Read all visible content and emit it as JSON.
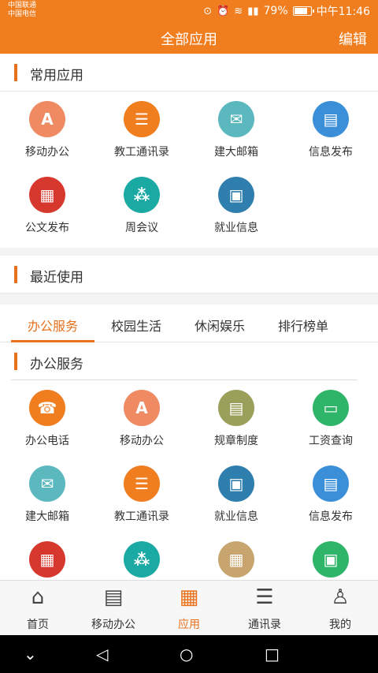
{
  "status": {
    "carrier1": "中国联通",
    "carrier2": "中国电信",
    "battery": "79%",
    "time": "中午11:46"
  },
  "nav": {
    "title": "全部应用",
    "edit": "编辑"
  },
  "common": {
    "title": "常用应用",
    "items": [
      {
        "label": "移动办公",
        "icon": "A",
        "color": "#f08a62"
      },
      {
        "label": "教工通讯录",
        "icon": "☰",
        "color": "#f07d1e"
      },
      {
        "label": "建大邮箱",
        "icon": "✉",
        "color": "#5ab8be"
      },
      {
        "label": "信息发布",
        "icon": "▤",
        "color": "#3a8fd8"
      },
      {
        "label": "公文发布",
        "icon": "▦",
        "color": "#d7382e"
      },
      {
        "label": "周会议",
        "icon": "⁂",
        "color": "#1aa9a3"
      },
      {
        "label": "就业信息",
        "icon": "▣",
        "color": "#2f7fae"
      }
    ]
  },
  "recent": {
    "title": "最近使用"
  },
  "tabs": [
    "办公服务",
    "校园生活",
    "休闲娱乐",
    "排行榜单"
  ],
  "office": {
    "title": "办公服务",
    "items": [
      {
        "label": "办公电话",
        "icon": "☎",
        "color": "#f07d1e"
      },
      {
        "label": "移动办公",
        "icon": "A",
        "color": "#f08a62"
      },
      {
        "label": "规章制度",
        "icon": "▤",
        "color": "#9aa05a"
      },
      {
        "label": "工资查询",
        "icon": "▭",
        "color": "#2fb56a"
      },
      {
        "label": "建大邮箱",
        "icon": "✉",
        "color": "#5ab8be"
      },
      {
        "label": "教工通讯录",
        "icon": "☰",
        "color": "#f07d1e"
      },
      {
        "label": "就业信息",
        "icon": "▣",
        "color": "#2f7fae"
      },
      {
        "label": "信息发布",
        "icon": "▤",
        "color": "#3a8fd8"
      },
      {
        "label": "",
        "icon": "▦",
        "color": "#d7382e"
      },
      {
        "label": "",
        "icon": "⁂",
        "color": "#1aa9a3"
      },
      {
        "label": "",
        "icon": "▦",
        "color": "#c8a46e"
      },
      {
        "label": "",
        "icon": "▣",
        "color": "#2fb56a"
      }
    ]
  },
  "bottom": [
    {
      "label": "首页",
      "icon": "⌂"
    },
    {
      "label": "移动办公",
      "icon": "▤"
    },
    {
      "label": "应用",
      "icon": "▦"
    },
    {
      "label": "通讯录",
      "icon": "☰"
    },
    {
      "label": "我的",
      "icon": "♙"
    }
  ]
}
